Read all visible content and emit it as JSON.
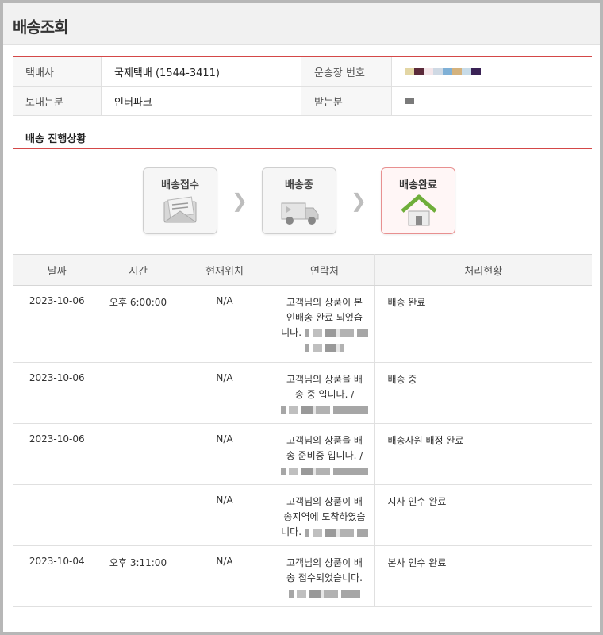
{
  "page": {
    "title": "배송조회"
  },
  "info": {
    "courier_label": "택배사",
    "courier_value": "국제택배 (1544-3411)",
    "tracking_label": "운송장 번호",
    "tracking_value_colors": [
      "#e3d6a4",
      "#5b2a3a",
      "#f4e6ea",
      "#cfd9e4",
      "#7fb0d6",
      "#d4b27d",
      "#c7dbe8",
      "#3a2255"
    ],
    "sender_label": "보내는분",
    "sender_value": "인터파크",
    "receiver_label": "받는분",
    "receiver_value_colors": [
      "#7a7a7a"
    ]
  },
  "progress": {
    "section_title": "배송 진행상황",
    "steps": [
      {
        "label": "배송접수",
        "icon": "envelope-icon"
      },
      {
        "label": "배송중",
        "icon": "truck-icon"
      },
      {
        "label": "배송완료",
        "icon": "house-icon"
      }
    ],
    "arrow_icon": "chevron-right-icon"
  },
  "history": {
    "headers": {
      "date": "날짜",
      "time": "시간",
      "location": "현재위치",
      "contact": "연락처",
      "status": "처리현황"
    },
    "rows": [
      {
        "date": "2023-10-06",
        "time": "오후 6:00:00",
        "location": "N/A",
        "contact_line1": "고객님의 상품이 본",
        "contact_line2": "인배송 완료 되었습",
        "contact_line3": "니다.",
        "status": "배송 완료"
      },
      {
        "date": "2023-10-06",
        "time": "",
        "location": "N/A",
        "contact_line1": "고객님의 상품을 배",
        "contact_line2": "송 중 입니다. /",
        "contact_line3": "",
        "status": "배송 중"
      },
      {
        "date": "2023-10-06",
        "time": "",
        "location": "N/A",
        "contact_line1": "고객님의 상품을 배",
        "contact_line2": "송 준비중 입니다. /",
        "contact_line3": "",
        "status": "배송사원 배정 완료"
      },
      {
        "date": "",
        "time": "",
        "location": "N/A",
        "contact_line1": "고객님의 상품이 배",
        "contact_line2": "송지역에 도착하였습",
        "contact_line3": "니다.",
        "status": "지사 인수 완료"
      },
      {
        "date": "2023-10-04",
        "time": "오후 3:11:00",
        "location": "N/A",
        "contact_line1": "고객님의 상품이 배",
        "contact_line2": "송 접수되었습니다.",
        "contact_line3": "",
        "status": "본사 인수 완료"
      }
    ]
  }
}
